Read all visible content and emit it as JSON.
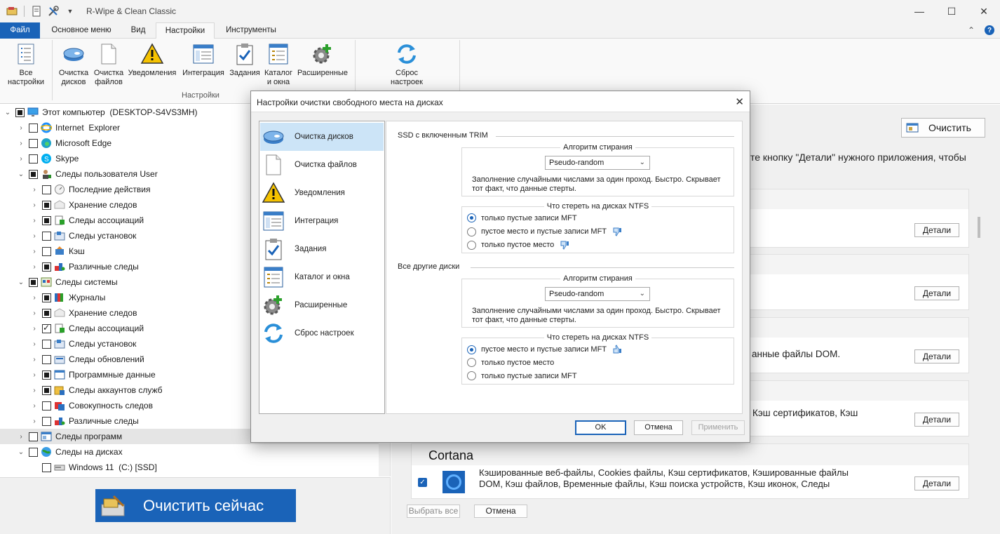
{
  "window": {
    "title": "R-Wipe & Clean Classic",
    "minimize": "—",
    "maximize": "☐",
    "close": "✕"
  },
  "quick_access": [
    "app-icon",
    "doc-icon",
    "tools-icon",
    "dropdown-icon"
  ],
  "tabs": [
    "Файл",
    "Основное меню",
    "Вид",
    "Настройки",
    "Инструменты"
  ],
  "active_tab": "Настройки",
  "ribbon": {
    "collapse": "⌃",
    "help": "?",
    "buttons": [
      {
        "label": "Все\nнастройки",
        "icon": "list-icon"
      },
      {
        "label": "Очистка\nдисков",
        "icon": "disk-icon"
      },
      {
        "label": "Очистка\nфайлов",
        "icon": "file-icon"
      },
      {
        "label": "Уведомления",
        "icon": "warning-icon"
      },
      {
        "label": "Интеграция",
        "icon": "window-icon"
      },
      {
        "label": "Задания",
        "icon": "task-icon"
      },
      {
        "label": "Каталог\nи окна",
        "icon": "catalog-icon"
      },
      {
        "label": "Расширенные",
        "icon": "gear-plus-icon"
      },
      {
        "label": "Сброс\nнастроек",
        "icon": "refresh-icon"
      }
    ],
    "group_label": "Настройки"
  },
  "tree": {
    "items": [
      {
        "label": "Этот компьютер  (DESKTOP-S4VS3MH)",
        "level": 0,
        "expander": "⌄",
        "check": "partial",
        "icon": "computer-icon"
      },
      {
        "label": "Internet  Explorer",
        "level": 1,
        "expander": "›",
        "check": "none",
        "icon": "ie-icon"
      },
      {
        "label": "Microsoft Edge",
        "level": 1,
        "expander": "›",
        "check": "none",
        "icon": "edge-icon"
      },
      {
        "label": "Skype",
        "level": 1,
        "expander": "›",
        "check": "none",
        "icon": "skype-icon"
      },
      {
        "label": "Следы пользователя User",
        "level": 1,
        "expander": "⌄",
        "check": "partial",
        "icon": "user-icon"
      },
      {
        "label": "Последние действия",
        "level": 2,
        "expander": "›",
        "check": "none",
        "icon": "clock-icon"
      },
      {
        "label": "Хранение следов",
        "level": 2,
        "expander": "›",
        "check": "partial",
        "icon": "storage-icon"
      },
      {
        "label": "Следы ассоциаций",
        "level": 2,
        "expander": "›",
        "check": "partial",
        "icon": "assoc-icon"
      },
      {
        "label": "Следы установок",
        "level": 2,
        "expander": "›",
        "check": "none",
        "icon": "install-icon"
      },
      {
        "label": "Кэш",
        "level": 2,
        "expander": "›",
        "check": "none",
        "icon": "cache-icon"
      },
      {
        "label": "Различные следы",
        "level": 2,
        "expander": "›",
        "check": "partial",
        "icon": "misc-icon"
      },
      {
        "label": "Следы системы",
        "level": 1,
        "expander": "⌄",
        "check": "partial",
        "icon": "system-icon"
      },
      {
        "label": "Журналы",
        "level": 2,
        "expander": "›",
        "check": "partial",
        "icon": "journal-icon"
      },
      {
        "label": "Хранение следов",
        "level": 2,
        "expander": "›",
        "check": "partial",
        "icon": "storage-icon"
      },
      {
        "label": "Следы ассоциаций",
        "level": 2,
        "expander": "›",
        "check": "checked",
        "icon": "assoc-icon"
      },
      {
        "label": "Следы установок",
        "level": 2,
        "expander": "›",
        "check": "none",
        "icon": "install-icon"
      },
      {
        "label": "Следы обновлений",
        "level": 2,
        "expander": "›",
        "check": "none",
        "icon": "update-icon"
      },
      {
        "label": "Программные данные",
        "level": 2,
        "expander": "›",
        "check": "partial",
        "icon": "progdata-icon"
      },
      {
        "label": "Следы аккаунтов служб",
        "level": 2,
        "expander": "›",
        "check": "partial",
        "icon": "accounts-icon"
      },
      {
        "label": "Совокупность следов",
        "level": 2,
        "expander": "›",
        "check": "none",
        "icon": "aggregate-icon"
      },
      {
        "label": "Различные следы",
        "level": 2,
        "expander": "›",
        "check": "none",
        "icon": "misc-icon"
      },
      {
        "label": "Следы программ",
        "level": 1,
        "expander": "›",
        "check": "none",
        "icon": "programs-icon",
        "selected": true
      },
      {
        "label": "Следы на дисках",
        "level": 1,
        "expander": "⌄",
        "check": "none",
        "icon": "globe-icon"
      },
      {
        "label": "Windows 11  (C:) [SSD]",
        "level": 2,
        "expander": "",
        "check": "none",
        "icon": "drive-icon"
      }
    ]
  },
  "clean_now": "Очистить сейчас",
  "right": {
    "clean_button": "Очистить",
    "hint_text": "те кнопку \"Детали\" нужного приложения, чтобы",
    "details_label": "Детали",
    "card_texts": [
      "",
      "",
      "анные файлы DOM.",
      "Кэш сертификатов, Кэш"
    ],
    "cortana": {
      "title": "Cortana",
      "text_line1": "Кэшированные веб-файлы, Cookies файлы, Кэш сертификатов, Кэшированные файлы",
      "text_line2": "DOM, Кэш файлов, Временные файлы, Кэш поиска устройств, Кэш иконок, Следы"
    },
    "select_all": "Выбрать все",
    "cancel": "Отмена"
  },
  "dialog": {
    "title": "Настройки очистки свободного места на дисках",
    "close": "✕",
    "nav": [
      {
        "label": "Очистка дисков",
        "icon": "disk-icon",
        "active": true
      },
      {
        "label": "Очистка файлов",
        "icon": "file-icon"
      },
      {
        "label": "Уведомления",
        "icon": "warning-icon"
      },
      {
        "label": "Интеграция",
        "icon": "window-icon"
      },
      {
        "label": "Задания",
        "icon": "task-icon"
      },
      {
        "label": "Каталог и окна",
        "icon": "catalog-icon"
      },
      {
        "label": "Расширенные",
        "icon": "gear-plus-icon"
      },
      {
        "label": "Сброс настроек",
        "icon": "refresh-icon"
      }
    ],
    "ssd_section": {
      "title": "SSD с включенным TRIM",
      "algo_legend": "Алгоритм стирания",
      "algo_value": "Pseudo-random",
      "algo_desc": "Заполнение случайными числами за один проход. Быстро. Скрывает тот факт, что данные стерты.",
      "ntfs_legend": "Что стереть на дисках NTFS",
      "options": [
        {
          "label": "только пустые записи MFT",
          "selected": true,
          "thumb": ""
        },
        {
          "label": "пустое место и пустые записи MFT",
          "selected": false,
          "thumb": "down"
        },
        {
          "label": "только пустое место",
          "selected": false,
          "thumb": "down"
        }
      ]
    },
    "other_section": {
      "title": "Все другие диски",
      "algo_legend": "Алгоритм стирания",
      "algo_value": "Pseudo-random",
      "algo_desc": "Заполнение случайными числами за один проход. Быстро. Скрывает тот факт, что данные стерты.",
      "ntfs_legend": "Что стереть на дисках NTFS",
      "options": [
        {
          "label": "пустое место и пустые записи MFT",
          "selected": true,
          "thumb": "up"
        },
        {
          "label": "только пустое место",
          "selected": false,
          "thumb": ""
        },
        {
          "label": "только пустые записи MFT",
          "selected": false,
          "thumb": ""
        }
      ]
    },
    "buttons": {
      "ok": "OK",
      "cancel": "Отмена",
      "apply": "Применить"
    }
  },
  "colors": {
    "accent": "#1a63b8",
    "nav_active": "#cce4f7",
    "tree_selected": "#e5e5e5"
  }
}
